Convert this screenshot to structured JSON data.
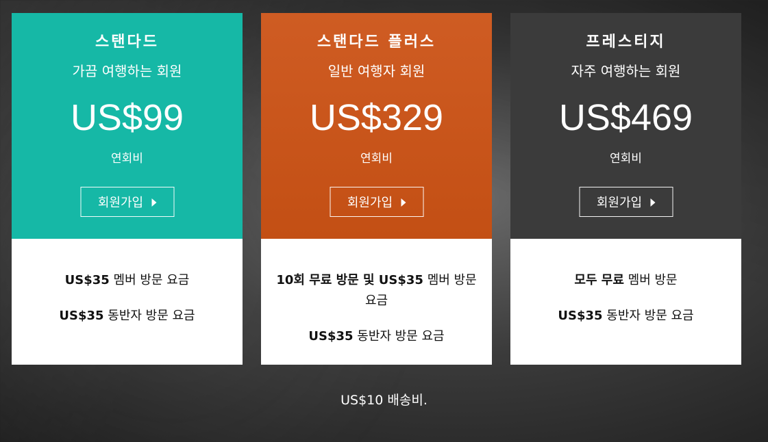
{
  "plans": [
    {
      "name": "스탠다드",
      "subtitle": "가끔 여행하는 회원",
      "price": "US$99",
      "fee_label": "연회비",
      "button_label": "회원가입",
      "color": "#16b8a6",
      "benefit_1_bold": "US$35",
      "benefit_1_rest": " 멤버 방문 요금",
      "benefit_2_bold": "US$35",
      "benefit_2_rest": " 동반자 방문 요금"
    },
    {
      "name": "스탠다드 플러스",
      "subtitle": "일반 여행자 회원",
      "price": "US$329",
      "fee_label": "연회비",
      "button_label": "회원가입",
      "color": "#c95517",
      "benefit_1_bold": "10회 무료 방문 및 US$35",
      "benefit_1_rest": " 멤버 방문 요금",
      "benefit_2_bold": "US$35",
      "benefit_2_rest": " 동반자 방문 요금"
    },
    {
      "name": "프레스티지",
      "subtitle": "자주 여행하는 회원",
      "price": "US$469",
      "fee_label": "연회비",
      "button_label": "회원가입",
      "color": "#3b3b3b",
      "benefit_1_bold": "모두 무료",
      "benefit_1_rest": " 멤버 방문",
      "benefit_2_bold": "US$35",
      "benefit_2_rest": " 동반자 방문 요금"
    }
  ],
  "footer_note": "US$10 배송비."
}
